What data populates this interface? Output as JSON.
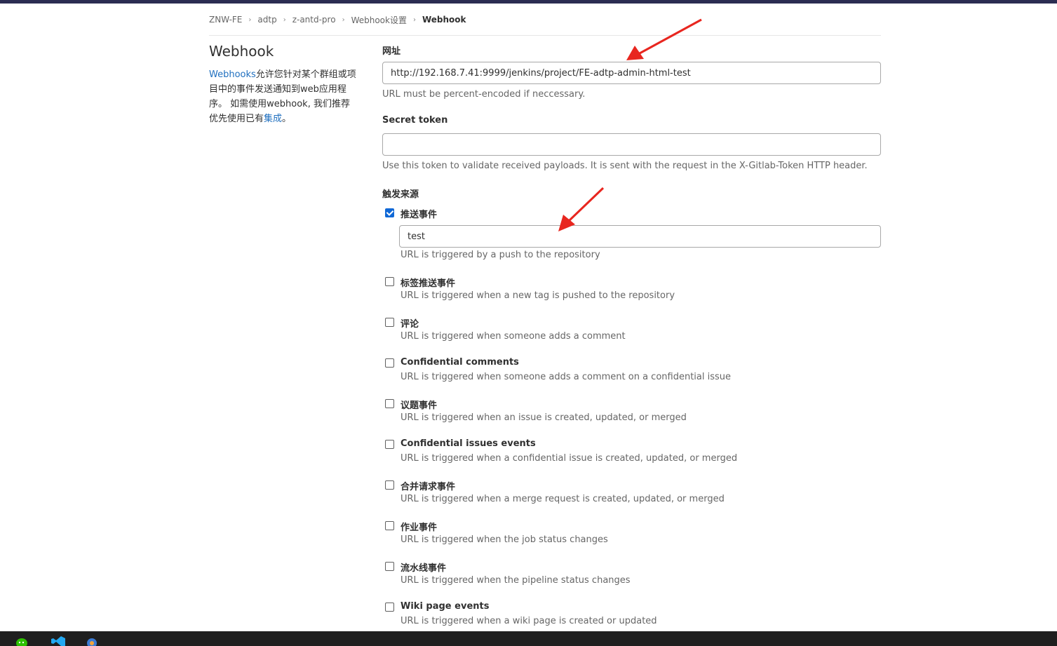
{
  "breadcrumb": {
    "items": [
      "ZNW-FE",
      "adtp",
      "z-antd-pro",
      "Webhook设置"
    ],
    "current": "Webhook"
  },
  "sidebar": {
    "title": "Webhook",
    "desc_link": "Webhooks",
    "desc_text1": "允许您针对某个群组或项目中的事件发送通知到web应用程序。 如需使用webhook, 我们推荐优先使用已有",
    "desc_link2": "集成",
    "desc_end": "。"
  },
  "url_field": {
    "label": "网址",
    "value": "http://192.168.7.41:9999/jenkins/project/FE-adtp-admin-html-test",
    "help": "URL must be percent-encoded if neccessary."
  },
  "token_field": {
    "label": "Secret token",
    "value": "",
    "help": "Use this token to validate received payloads. It is sent with the request in the X-Gitlab-Token HTTP header."
  },
  "triggers": {
    "heading": "触发来源",
    "push": {
      "label": "推送事件",
      "checked": true,
      "branch_filter": "test",
      "help": "URL is triggered by a push to the repository"
    },
    "events": [
      {
        "label": "标签推送事件",
        "help": "URL is triggered when a new tag is pushed to the repository"
      },
      {
        "label": "评论",
        "help": "URL is triggered when someone adds a comment"
      },
      {
        "label": "Confidential comments",
        "help": "URL is triggered when someone adds a comment on a confidential issue"
      },
      {
        "label": "议题事件",
        "help": "URL is triggered when an issue is created, updated, or merged"
      },
      {
        "label": "Confidential issues events",
        "help": "URL is triggered when a confidential issue is created, updated, or merged"
      },
      {
        "label": "合并请求事件",
        "help": "URL is triggered when a merge request is created, updated, or merged"
      },
      {
        "label": "作业事件",
        "help": "URL is triggered when the job status changes"
      },
      {
        "label": "流水线事件",
        "help": "URL is triggered when the pipeline status changes"
      },
      {
        "label": "Wiki page events",
        "help": "URL is triggered when a wiki page is created or updated"
      }
    ]
  },
  "colors": {
    "accent": "#1068d6",
    "link": "#1f6fbf",
    "annotation_arrow": "#e8261f",
    "topbar": "#2b2d52"
  },
  "taskbar": {
    "icons": [
      "wechat-icon",
      "vscode-icon",
      "app-icon"
    ]
  }
}
